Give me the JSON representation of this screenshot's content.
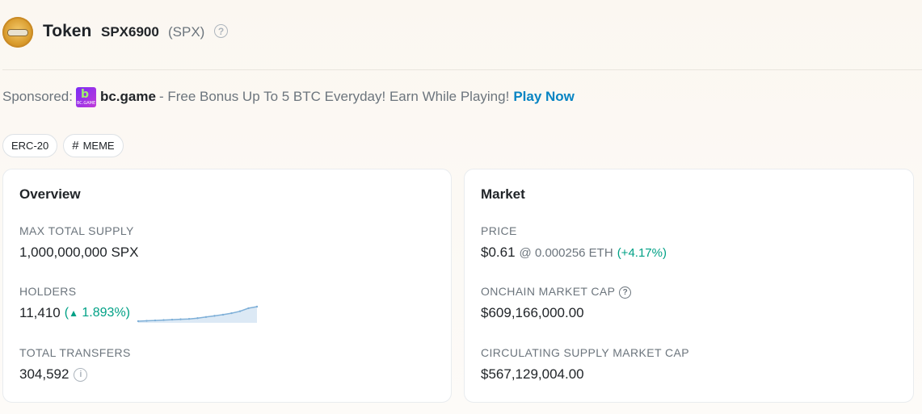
{
  "header": {
    "title": "Token",
    "token_name": "SPX6900",
    "token_symbol": "(SPX)",
    "help_icon": "question-circle-icon"
  },
  "sponsor": {
    "label": "Sponsored:",
    "brand": "bc.game",
    "text": "- Free Bonus Up To 5 BTC Everyday! Earn While Playing!",
    "cta": "Play Now"
  },
  "tags": [
    {
      "label": "ERC-20"
    },
    {
      "label": "MEME",
      "icon": "#"
    }
  ],
  "overview": {
    "title": "Overview",
    "max_supply_label": "MAX TOTAL SUPPLY",
    "max_supply_value": "1,000,000,000 SPX",
    "holders_label": "HOLDERS",
    "holders_value": "11,410",
    "holders_change_open": "(",
    "holders_change_arrow": "▲",
    "holders_change": "1.893%",
    "holders_change_close": ")",
    "holders_trend": [
      10,
      11,
      12,
      13,
      14,
      15,
      16,
      18,
      21,
      24,
      27,
      31,
      36,
      44,
      48
    ],
    "transfers_label": "TOTAL TRANSFERS",
    "transfers_value": "304,592"
  },
  "market": {
    "title": "Market",
    "price_label": "PRICE",
    "price_value": "$0.61",
    "price_eth": "@ 0.000256 ETH",
    "price_change": "(+4.17%)",
    "onchain_cap_label": "ONCHAIN MARKET CAP",
    "onchain_cap_value": "$609,166,000.00",
    "circ_cap_label": "CIRCULATING SUPPLY MARKET CAP",
    "circ_cap_value": "$567,129,004.00"
  },
  "colors": {
    "accent": "#0784c3",
    "positive": "#00a186",
    "spark_line": "#7fb0d8",
    "spark_fill": "#dce9f5"
  }
}
